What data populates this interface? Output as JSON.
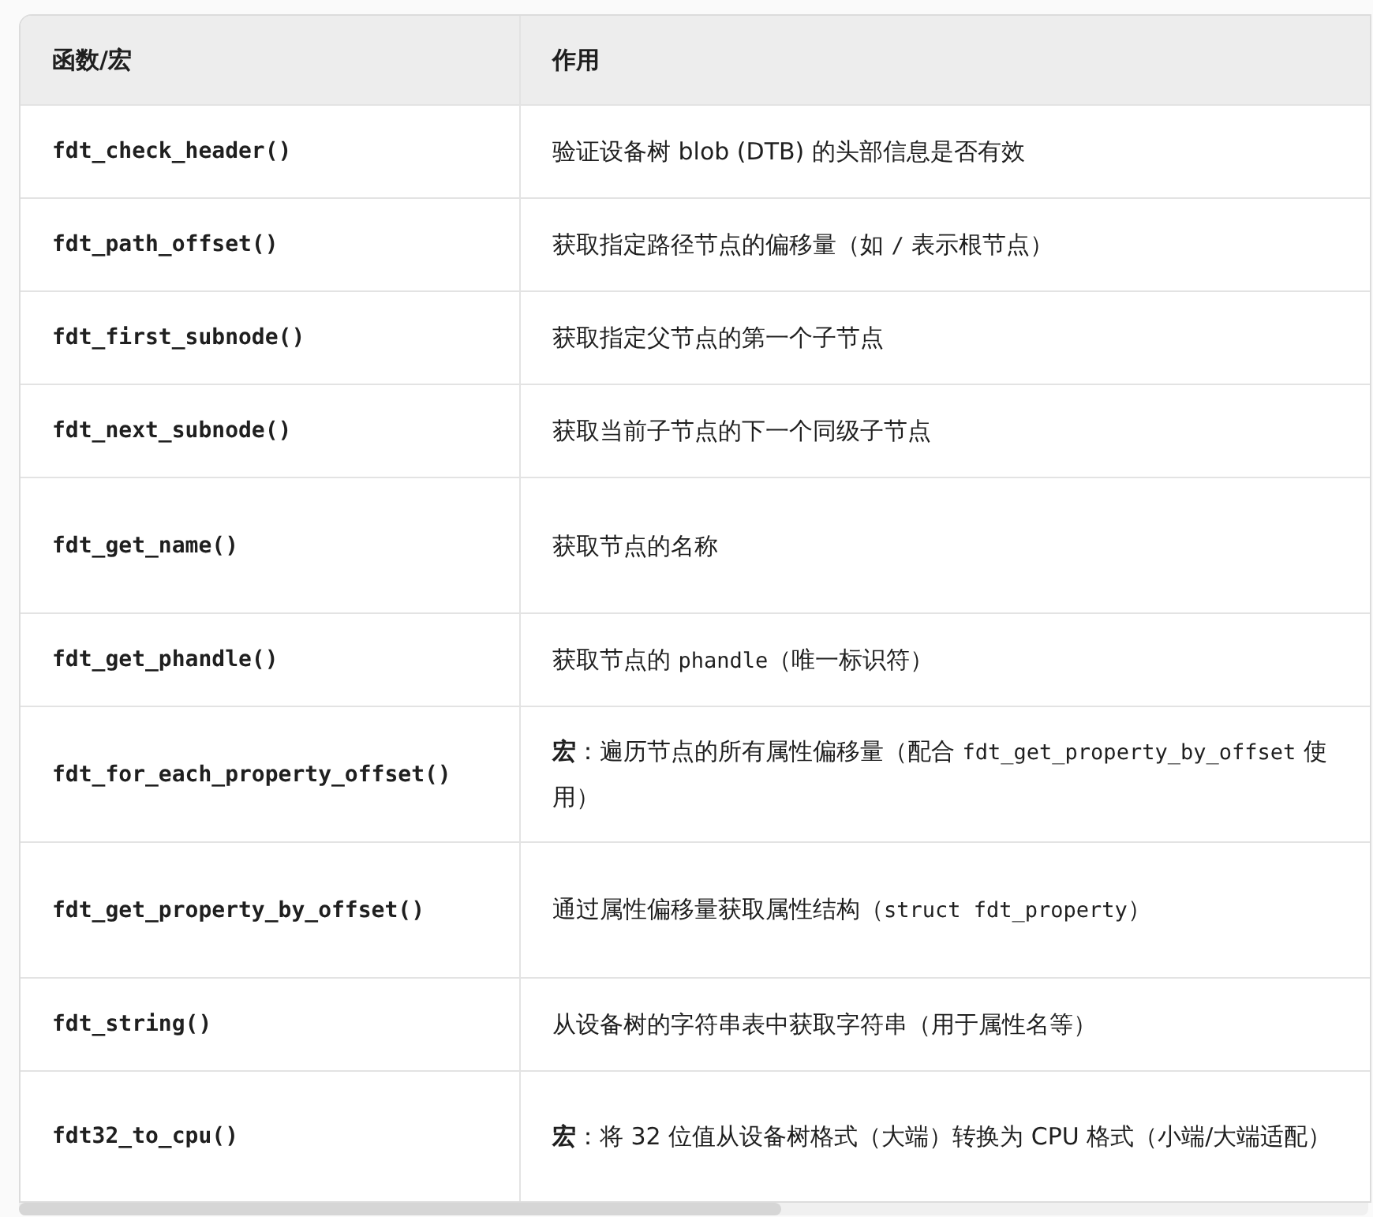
{
  "table": {
    "columns": [
      "函数/宏",
      "作用"
    ],
    "rows": [
      {
        "name": "fdt_check_header()",
        "description": [
          {
            "kind": "text",
            "text": "验证设备树 blob (DTB) 的头部信息是否有效"
          }
        ]
      },
      {
        "name": "fdt_path_offset()",
        "description": [
          {
            "kind": "text",
            "text": "获取指定路径节点的偏移量（如 "
          },
          {
            "kind": "code",
            "text": "/"
          },
          {
            "kind": "text",
            "text": " 表示根节点）"
          }
        ]
      },
      {
        "name": "fdt_first_subnode()",
        "description": [
          {
            "kind": "text",
            "text": "获取指定父节点的第一个子节点"
          }
        ]
      },
      {
        "name": "fdt_next_subnode()",
        "description": [
          {
            "kind": "text",
            "text": "获取当前子节点的下一个同级子节点"
          }
        ]
      },
      {
        "name": "fdt_get_name()",
        "description": [
          {
            "kind": "text",
            "text": "获取节点的名称"
          }
        ]
      },
      {
        "name": "fdt_get_phandle()",
        "description": [
          {
            "kind": "text",
            "text": "获取节点的 "
          },
          {
            "kind": "code",
            "text": "phandle"
          },
          {
            "kind": "text",
            "text": "（唯一标识符）"
          }
        ]
      },
      {
        "name": "fdt_for_each_property_offset()",
        "description": [
          {
            "kind": "bold",
            "text": "宏"
          },
          {
            "kind": "text",
            "text": "：遍历节点的所有属性偏移量（配合 "
          },
          {
            "kind": "code",
            "text": "fdt_get_property_by_offset"
          },
          {
            "kind": "text",
            "text": " 使用）"
          }
        ]
      },
      {
        "name": "fdt_get_property_by_offset()",
        "description": [
          {
            "kind": "text",
            "text": "通过属性偏移量获取属性结构（"
          },
          {
            "kind": "code",
            "text": "struct fdt_property"
          },
          {
            "kind": "text",
            "text": "）"
          }
        ]
      },
      {
        "name": "fdt_string()",
        "description": [
          {
            "kind": "text",
            "text": "从设备树的字符串表中获取字符串（用于属性名等）"
          }
        ]
      },
      {
        "name": "fdt32_to_cpu()",
        "description": [
          {
            "kind": "bold",
            "text": "宏"
          },
          {
            "kind": "text",
            "text": "：将 32 位值从设备树格式（大端）转换为 CPU 格式（小端/大端适配）"
          }
        ]
      }
    ]
  }
}
